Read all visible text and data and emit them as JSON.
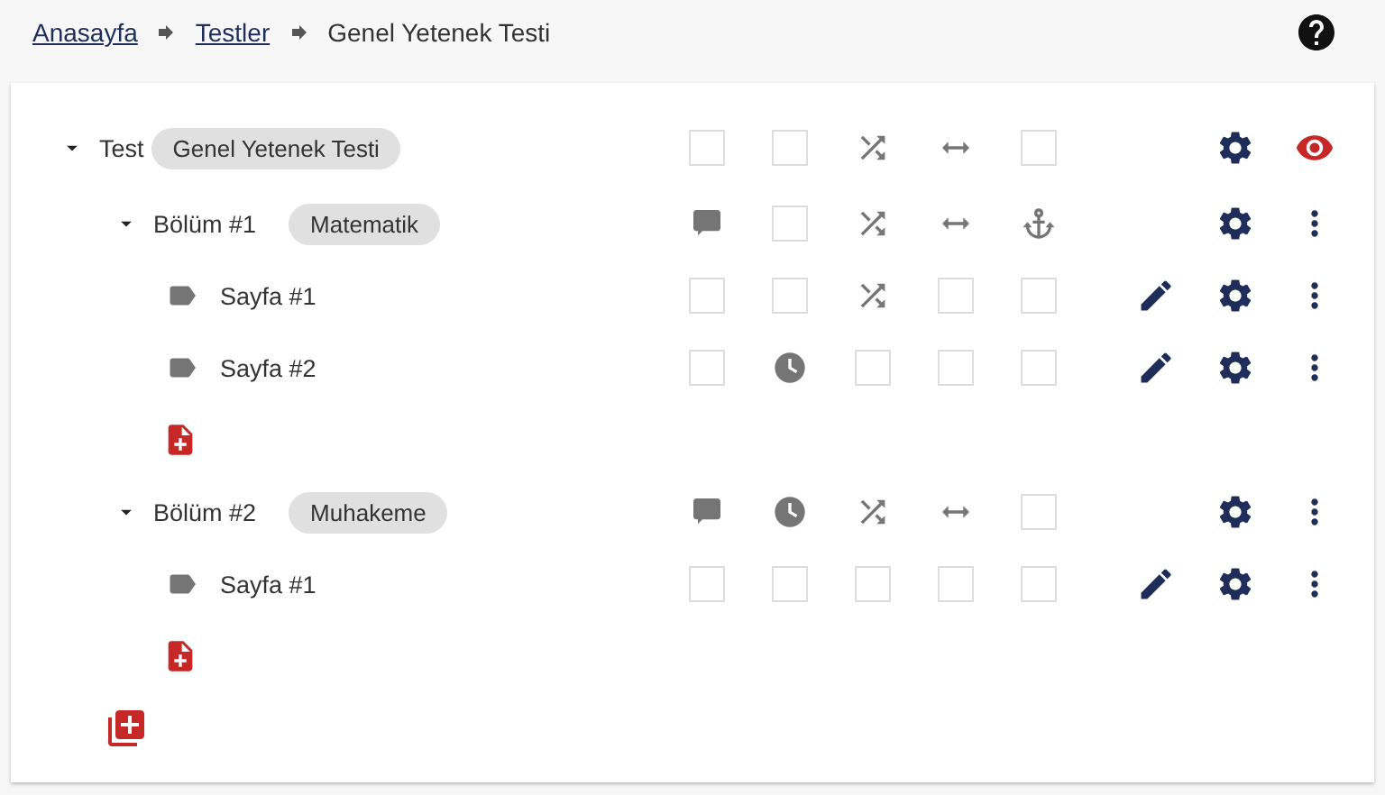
{
  "breadcrumb": [
    {
      "label": "Anasayfa",
      "kind": "link"
    },
    {
      "label": "Testler",
      "kind": "link"
    },
    {
      "label": "Genel Yetenek Testi",
      "kind": "current"
    }
  ],
  "tree": {
    "kind": "test",
    "label": "Test",
    "tag": "Genel Yetenek Testi",
    "expanded": true,
    "options": [
      {
        "kind": "box",
        "checked": false
      },
      {
        "kind": "box",
        "checked": false
      },
      {
        "kind": "shuffle"
      },
      {
        "kind": "width"
      },
      {
        "kind": "box",
        "checked": false
      }
    ],
    "actions": [
      {
        "kind": "settings"
      },
      {
        "kind": "view"
      }
    ],
    "children": [
      {
        "kind": "section",
        "label": "Bölüm #1",
        "tag": "Matematik",
        "expanded": true,
        "options": [
          {
            "kind": "comment"
          },
          {
            "kind": "box",
            "checked": false
          },
          {
            "kind": "shuffle"
          },
          {
            "kind": "width"
          },
          {
            "kind": "anchor"
          }
        ],
        "actions": [
          {
            "kind": "settings"
          },
          {
            "kind": "more"
          }
        ],
        "children": [
          {
            "kind": "page",
            "label": "Sayfa #1",
            "options": [
              {
                "kind": "box",
                "checked": false
              },
              {
                "kind": "box",
                "checked": false
              },
              {
                "kind": "shuffle"
              },
              {
                "kind": "box",
                "checked": false
              },
              {
                "kind": "box",
                "checked": false
              }
            ],
            "actions": [
              {
                "kind": "edit"
              },
              {
                "kind": "settings"
              },
              {
                "kind": "more"
              }
            ]
          },
          {
            "kind": "page",
            "label": "Sayfa #2",
            "options": [
              {
                "kind": "box",
                "checked": false
              },
              {
                "kind": "clock"
              },
              {
                "kind": "box",
                "checked": false
              },
              {
                "kind": "box",
                "checked": false
              },
              {
                "kind": "box",
                "checked": false
              }
            ],
            "actions": [
              {
                "kind": "edit"
              },
              {
                "kind": "settings"
              },
              {
                "kind": "more"
              }
            ]
          }
        ]
      },
      {
        "kind": "section",
        "label": "Bölüm #2",
        "tag": "Muhakeme",
        "expanded": true,
        "options": [
          {
            "kind": "comment"
          },
          {
            "kind": "clock"
          },
          {
            "kind": "shuffle"
          },
          {
            "kind": "width"
          },
          {
            "kind": "box",
            "checked": false
          }
        ],
        "actions": [
          {
            "kind": "settings"
          },
          {
            "kind": "more"
          }
        ],
        "children": [
          {
            "kind": "page",
            "label": "Sayfa #1",
            "options": [
              {
                "kind": "box",
                "checked": false
              },
              {
                "kind": "box",
                "checked": false
              },
              {
                "kind": "box",
                "checked": false
              },
              {
                "kind": "box",
                "checked": false
              },
              {
                "kind": "box",
                "checked": false
              }
            ],
            "actions": [
              {
                "kind": "edit"
              },
              {
                "kind": "settings"
              },
              {
                "kind": "more"
              }
            ]
          }
        ]
      }
    ]
  }
}
